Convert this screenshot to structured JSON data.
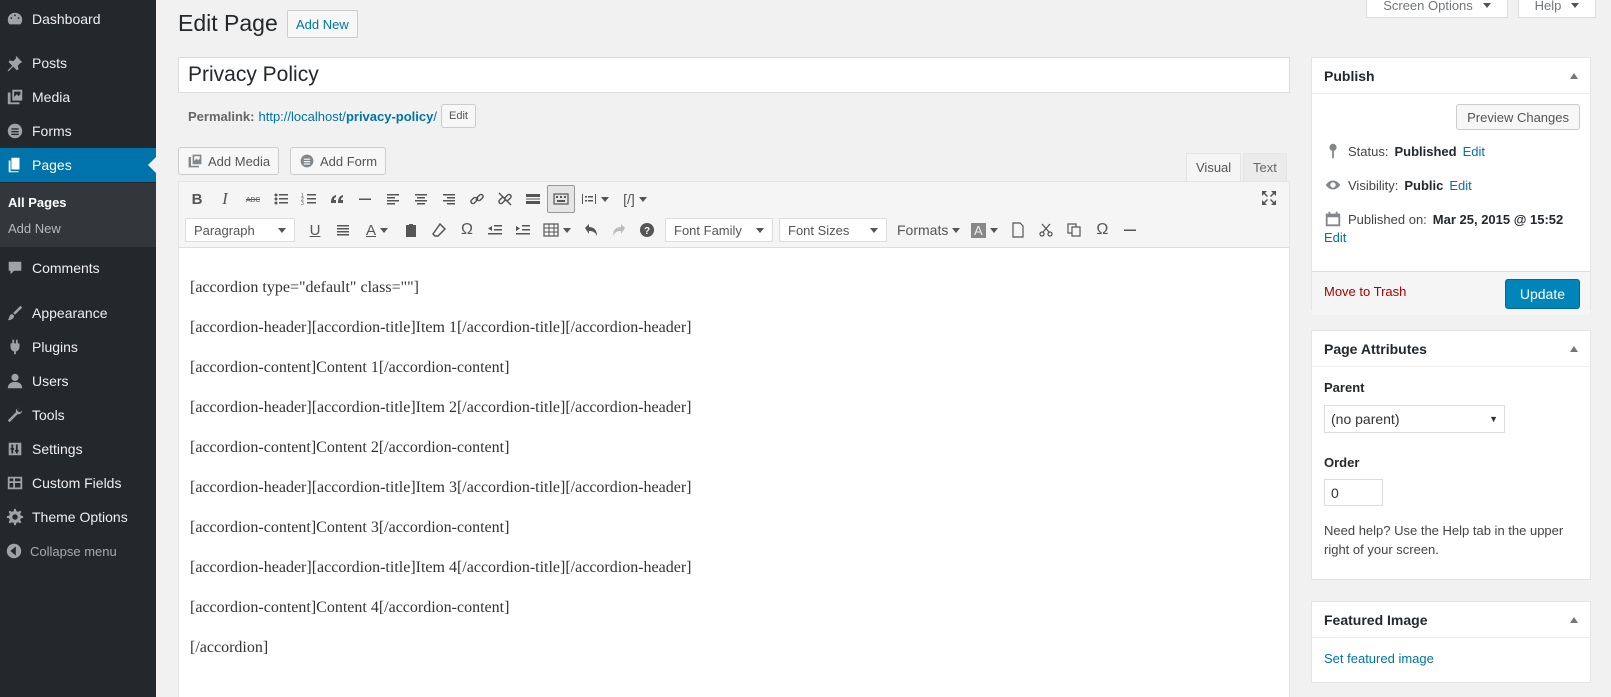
{
  "sidebar": {
    "items": [
      {
        "label": "Dashboard",
        "icon": "dashboard-icon"
      },
      {
        "label": "Posts",
        "icon": "pin-icon"
      },
      {
        "label": "Media",
        "icon": "media-icon"
      },
      {
        "label": "Forms",
        "icon": "forms-icon"
      },
      {
        "label": "Pages",
        "icon": "pages-icon"
      },
      {
        "label": "Comments",
        "icon": "comment-icon"
      },
      {
        "label": "Appearance",
        "icon": "brush-icon"
      },
      {
        "label": "Plugins",
        "icon": "plug-icon"
      },
      {
        "label": "Users",
        "icon": "user-icon"
      },
      {
        "label": "Tools",
        "icon": "wrench-icon"
      },
      {
        "label": "Settings",
        "icon": "settings-icon"
      },
      {
        "label": "Custom Fields",
        "icon": "table-icon"
      },
      {
        "label": "Theme Options",
        "icon": "gear-icon"
      }
    ],
    "submenu": [
      "All Pages",
      "Add New"
    ],
    "collapse_label": "Collapse menu"
  },
  "top": {
    "screen_options": "Screen Options",
    "help": "Help"
  },
  "header": {
    "title": "Edit Page",
    "add_new": "Add New"
  },
  "post": {
    "title": "Privacy Policy",
    "permalink_label": "Permalink:",
    "permalink_base": "http://localhost/",
    "permalink_slug": "privacy-policy",
    "permalink_end": "/",
    "permalink_edit": "Edit"
  },
  "media_buttons": {
    "add_media": "Add Media",
    "add_form": "Add Form"
  },
  "editor_tabs": {
    "visual": "Visual",
    "text": "Text"
  },
  "toolbar": {
    "format_select": "Paragraph",
    "font_family": "Font Family",
    "font_sizes": "Font Sizes",
    "formats": "Formats",
    "shortcode_label": "[/]"
  },
  "content": [
    "[accordion type=\"default\" class=\"\"]",
    "[accordion-header][accordion-title]Item 1[/accordion-title][/accordion-header]",
    "[accordion-content]Content 1[/accordion-content]",
    "[accordion-header][accordion-title]Item 2[/accordion-title][/accordion-header]",
    "[accordion-content]Content 2[/accordion-content]",
    "[accordion-header][accordion-title]Item 3[/accordion-title][/accordion-header]",
    "[accordion-content]Content 3[/accordion-content]",
    "[accordion-header][accordion-title]Item 4[/accordion-title][/accordion-header]",
    "[accordion-content]Content 4[/accordion-content]",
    "[/accordion]"
  ],
  "publish": {
    "title": "Publish",
    "preview": "Preview Changes",
    "status_label": "Status:",
    "status_value": "Published",
    "visibility_label": "Visibility:",
    "visibility_value": "Public",
    "published_label": "Published on:",
    "published_value": "Mar 25, 2015 @ 15:52",
    "edit": "Edit",
    "trash": "Move to Trash",
    "update": "Update"
  },
  "attributes": {
    "title": "Page Attributes",
    "parent_label": "Parent",
    "parent_value": "(no parent)",
    "order_label": "Order",
    "order_value": "0",
    "help": "Need help? Use the Help tab in the upper right of your screen."
  },
  "featured": {
    "title": "Featured Image",
    "link": "Set featured image"
  },
  "colors": {
    "sidebar": "#23282d",
    "accent": "#0073aa",
    "update_button": "#0085ba",
    "trash": "#aa0000"
  }
}
